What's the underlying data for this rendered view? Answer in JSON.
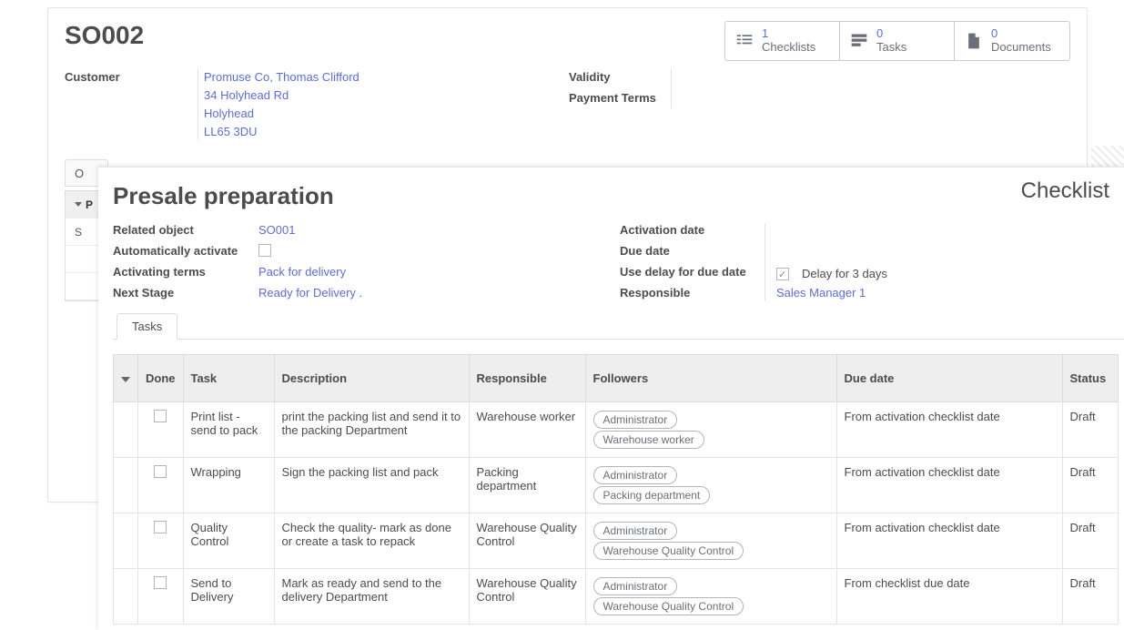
{
  "header": {
    "title": "SO002",
    "stats": [
      {
        "count": "1",
        "label": "Checklists"
      },
      {
        "count": "0",
        "label": "Tasks"
      },
      {
        "count": "0",
        "label": "Documents"
      }
    ]
  },
  "fields": {
    "customer_label": "Customer",
    "customer_lines": [
      "Promuse Co, Thomas Clifford",
      "34 Holyhead Rd",
      "Holyhead",
      "LL65 3DU"
    ],
    "validity_label": "Validity",
    "payment_label": "Payment Terms"
  },
  "main_tabs": {
    "tab1_partial": "O",
    "grid_header_partial": "P",
    "grid_row_partial": "S"
  },
  "checklist": {
    "panel_title": "Checklist",
    "name": "Presale preparation",
    "labels": {
      "related_object": "Related object",
      "auto_activate": "Automatically activate",
      "activating_terms": "Activating terms",
      "next_stage": "Next Stage",
      "activation_date": "Activation date",
      "due_date": "Due date",
      "use_delay": "Use delay for due date",
      "responsible": "Responsible"
    },
    "values": {
      "related_object": "SO001",
      "auto_activate_checked": false,
      "activating_terms": "Pack for delivery",
      "next_stage": "Ready for Delivery .",
      "use_delay_checked": true,
      "delay_text": "Delay for 3 days",
      "responsible": "Sales Manager 1"
    },
    "tab_label": "Tasks"
  },
  "task_table": {
    "headers": {
      "done": "Done",
      "task": "Task",
      "description": "Description",
      "responsible": "Responsible",
      "followers": "Followers",
      "due_date": "Due date",
      "status": "Status"
    },
    "rows": [
      {
        "task": "Print list - send to pack",
        "description": "print the packing list and send it to the packing Department",
        "responsible": "Warehouse worker",
        "followers": [
          "Administrator",
          "Warehouse worker"
        ],
        "due_date": "From activation checklist date",
        "status": "Draft"
      },
      {
        "task": "Wrapping",
        "description": "Sign the packing list and pack",
        "responsible": "Packing department",
        "followers": [
          "Administrator",
          "Packing department"
        ],
        "due_date": "From activation checklist date",
        "status": "Draft"
      },
      {
        "task": "Quality Control",
        "description": "Check the quality- mark as done or create a task to repack",
        "responsible": "Warehouse Quality Control",
        "followers": [
          "Administrator",
          "Warehouse Quality Control"
        ],
        "due_date": "From activation checklist date",
        "status": "Draft"
      },
      {
        "task": "Send to Delivery",
        "description": "Mark as ready and send to the delivery Department",
        "responsible": "Warehouse Quality Control",
        "followers": [
          "Administrator",
          "Warehouse Quality Control"
        ],
        "due_date": "From checklist due date",
        "status": "Draft"
      }
    ]
  }
}
